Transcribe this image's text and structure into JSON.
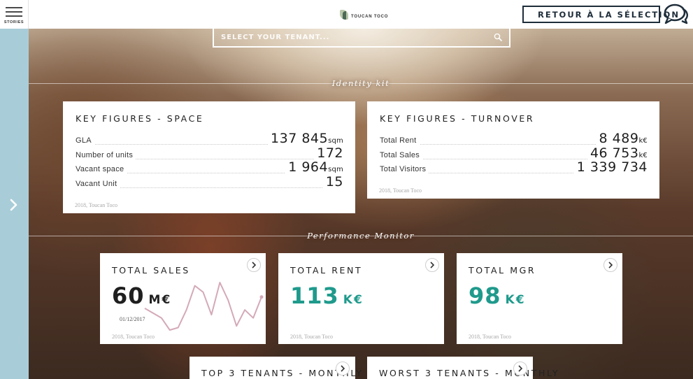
{
  "header": {
    "menu_label": "STORIES",
    "logo_text": "TOUCAN TOCO",
    "back_label": "RETOUR À LA SÉLECTION"
  },
  "search": {
    "placeholder": "SELECT YOUR TENANT..."
  },
  "sections": {
    "identity": "Identity kit",
    "performance": "Performance Monitor"
  },
  "space": {
    "title": "KEY FIGURES - SPACE",
    "rows": [
      {
        "label": "GLA",
        "value": "137 845",
        "unit": "sqm"
      },
      {
        "label": "Number of units",
        "value": "172",
        "unit": ""
      },
      {
        "label": "Vacant space",
        "value": "1 964",
        "unit": "sqm"
      },
      {
        "label": "Vacant Unit",
        "value": "15",
        "unit": ""
      }
    ],
    "source": "2018, Toucan Toco"
  },
  "turnover": {
    "title": "KEY FIGURES - TURNOVER",
    "rows": [
      {
        "label": "Total Rent",
        "value": "8 489",
        "unit": "k€"
      },
      {
        "label": "Total Sales",
        "value": "46 753",
        "unit": "k€"
      },
      {
        "label": "Total Visitors",
        "value": "1 339 734",
        "unit": ""
      }
    ],
    "source": "2018, Toucan Toco"
  },
  "cards": {
    "sales": {
      "title": "TOTAL SALES",
      "value": "60",
      "unit": "M€",
      "date": "01/12/2017",
      "source": "2018, Toucan Toco"
    },
    "rent": {
      "title": "TOTAL RENT",
      "value": "113",
      "unit": "K€",
      "source": "2018, Toucan Toco"
    },
    "mgr": {
      "title": "TOTAL MGR",
      "value": "98",
      "unit": "K€",
      "source": "2018, Toucan Toco"
    },
    "top3": {
      "title": "TOP 3 TENANTS - MONTHLY"
    },
    "worst3": {
      "title": "WORST 3 TENANTS - MONTHLY"
    }
  },
  "colors": {
    "accent_teal": "#1f9a8c",
    "sparkline": "#d4a9b8",
    "rail": "#a9cdd8",
    "navy": "#1e2d3a"
  },
  "sparkline": {
    "values": [
      60,
      54,
      48,
      33,
      36,
      58,
      88,
      80,
      52,
      92,
      70,
      38,
      58,
      48,
      74
    ]
  }
}
